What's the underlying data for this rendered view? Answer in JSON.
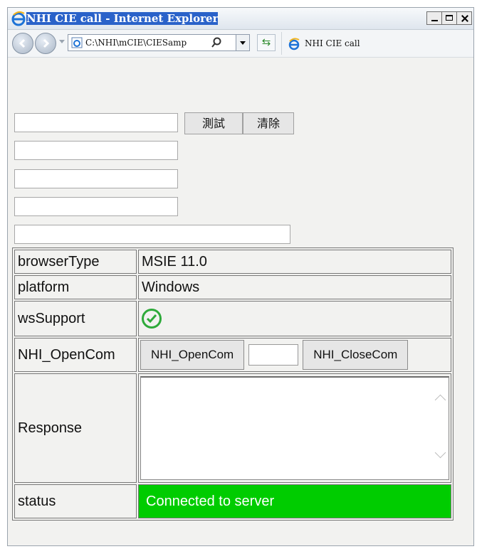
{
  "window": {
    "title": "NHI CIE call - Internet Explorer",
    "title_highlight": "NHI CIE call - Internet Explorer"
  },
  "navbar": {
    "address": "C:\\NHI\\mCIE\\CIESamp",
    "tab_title": "NHI CIE call"
  },
  "form": {
    "test_button": "測試",
    "clear_button": "清除"
  },
  "table": {
    "rows": [
      {
        "label": "browserType",
        "value": "MSIE 11.0"
      },
      {
        "label": "platform",
        "value": "Windows"
      },
      {
        "label": "wsSupport",
        "value": ""
      },
      {
        "label": "NHI_OpenCom",
        "value": ""
      },
      {
        "label": "Response",
        "value": ""
      },
      {
        "label": "status",
        "value": "Connected to server"
      }
    ],
    "open_button": "NHI_OpenCom",
    "close_button": "NHI_CloseCom"
  },
  "colors": {
    "status_bg": "#00cc00",
    "check_green": "#2eaa3a"
  },
  "icons": [
    "ie-icon",
    "back-icon",
    "forward-icon",
    "search-icon",
    "refresh-icon",
    "check-icon",
    "minimize-icon",
    "maximize-icon",
    "close-icon"
  ]
}
